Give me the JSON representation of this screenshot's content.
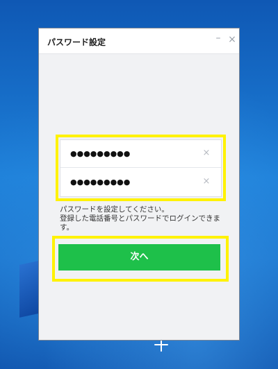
{
  "window": {
    "title": "パスワード設定",
    "minimize_glyph": "–",
    "close_glyph": "×"
  },
  "form": {
    "password_value": "●●●●●●●●●",
    "confirm_value": "●●●●●●●●●",
    "clear_glyph": "×",
    "help_line1": "パスワードを設定してください。",
    "help_line2": "登録した電話番号とパスワードでログインできます。",
    "next_label": "次へ"
  },
  "icons": {
    "minimize": "minimize-icon",
    "close": "close-icon",
    "clear": "clear-icon"
  },
  "colors": {
    "accent_button": "#1ec04a",
    "highlight": "#fff200",
    "desktop": "#1d7fd8"
  }
}
